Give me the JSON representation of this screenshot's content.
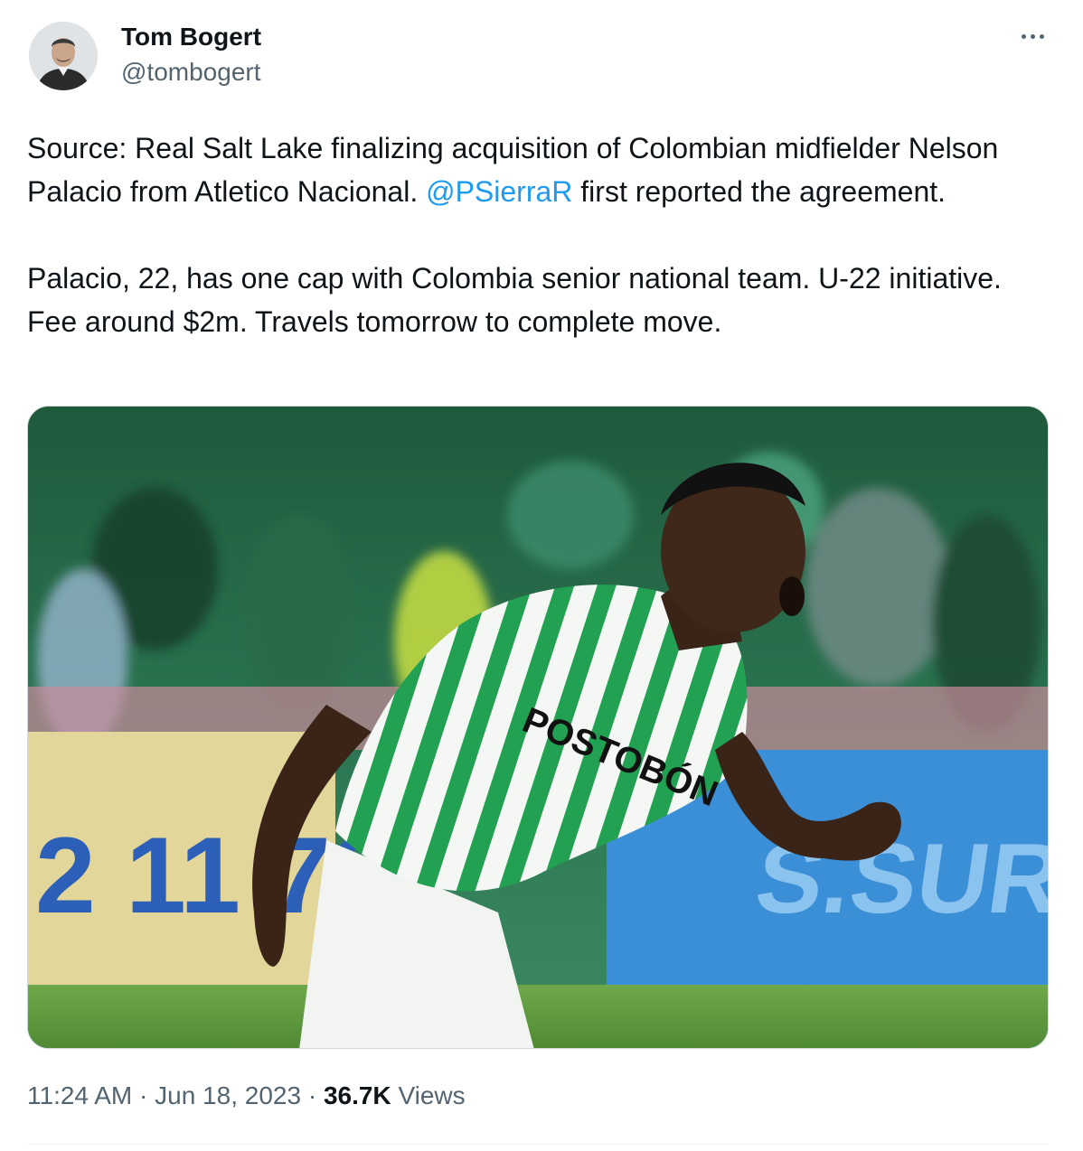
{
  "author": {
    "name": "Tom Bogert",
    "handle": "@tombogert"
  },
  "tweet": {
    "paragraph1": {
      "before_mention": "Source: Real Salt Lake finalizing acquisition of Colombian midfielder Nelson Palacio from Atletico Nacional. ",
      "mention": "@PSierraR",
      "after_mention": " first reported the agreement."
    },
    "paragraph2": "Palacio, 22, has one cap with Colombia senior national team. U-22 initiative. Fee around $2m. Travels tomorrow to complete move."
  },
  "media": {
    "jersey_sponsor": "POSTOBÓN",
    "board_digits": "2 11 72"
  },
  "meta": {
    "time": "11:24 AM",
    "separator": " · ",
    "date": "Jun 18, 2023",
    "views_count": "36.7K",
    "views_label": "Views"
  },
  "colors": {
    "text": "#0f1419",
    "secondary": "#536471",
    "link": "#1d9bf0",
    "border": "#cfd9de"
  },
  "icons": {
    "more": "more-horizontal-icon"
  }
}
